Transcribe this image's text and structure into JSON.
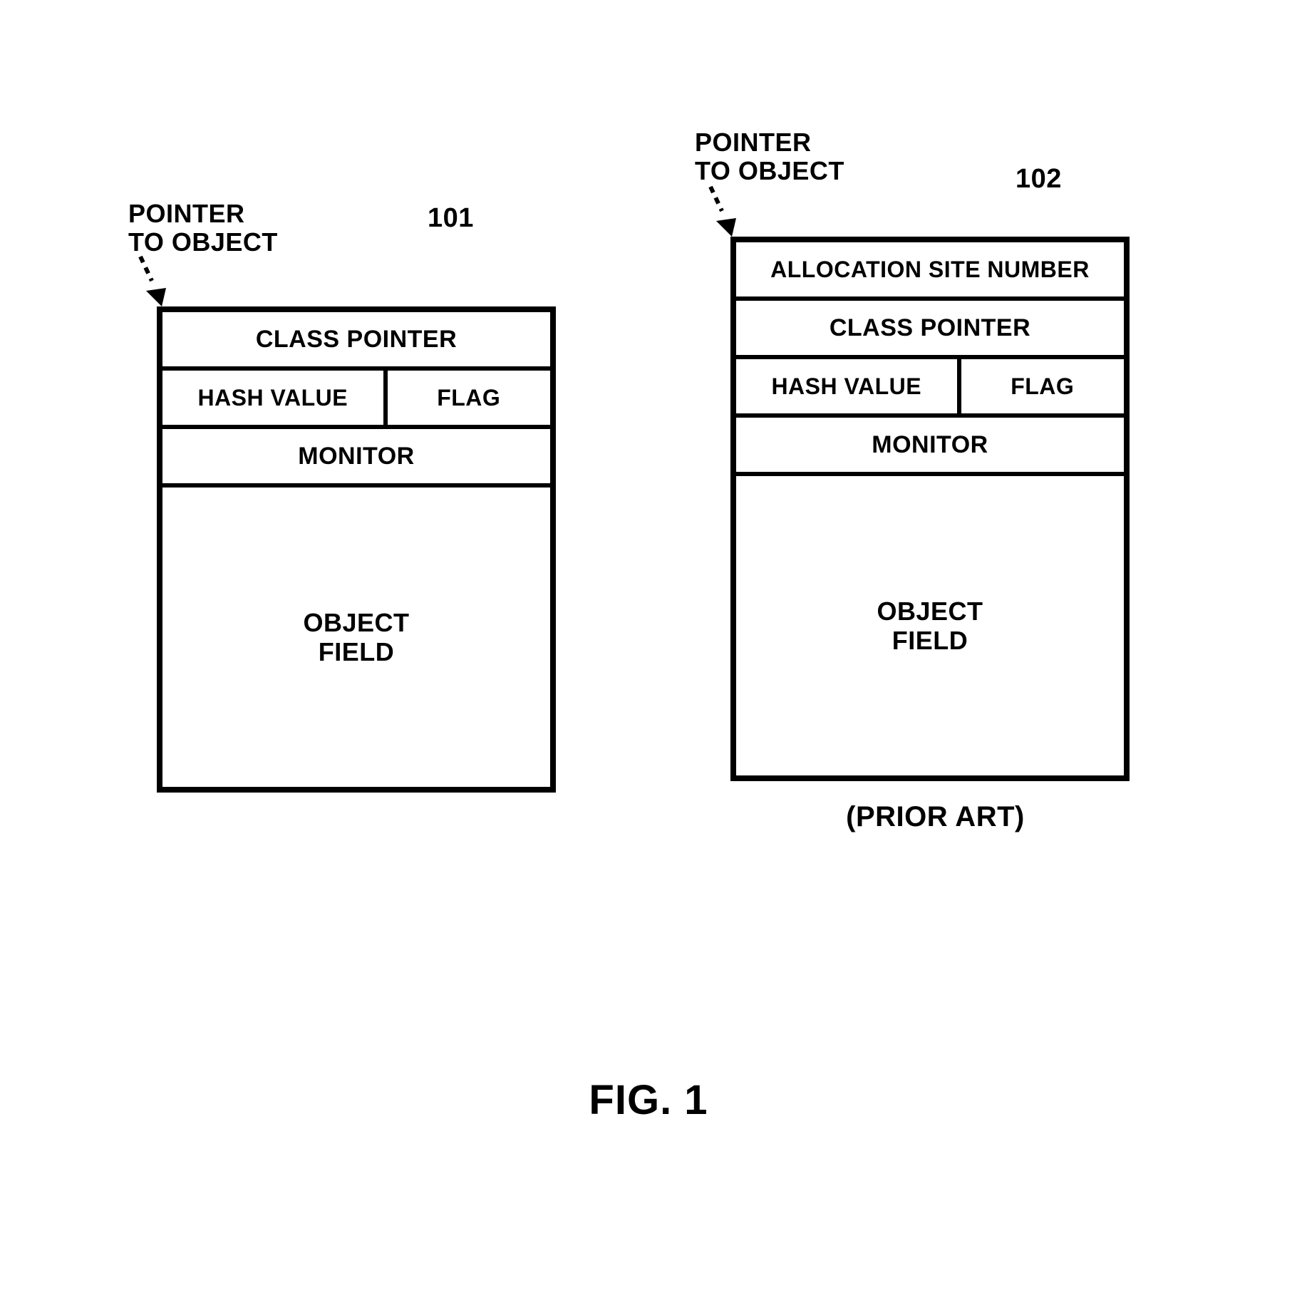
{
  "figure_caption": "FIG. 1",
  "left": {
    "ref": "101",
    "pointer_label_l1": "POINTER",
    "pointer_label_l2": "TO OBJECT",
    "rows": {
      "class_pointer": "CLASS POINTER",
      "hash_value": "HASH VALUE",
      "flag": "FLAG",
      "monitor": "MONITOR",
      "object_field_l1": "OBJECT",
      "object_field_l2": "FIELD"
    }
  },
  "right": {
    "ref": "102",
    "pointer_label_l1": "POINTER",
    "pointer_label_l2": "TO OBJECT",
    "rows": {
      "alloc_site": "ALLOCATION SITE NUMBER",
      "class_pointer": "CLASS POINTER",
      "hash_value": "HASH VALUE",
      "flag": "FLAG",
      "monitor": "MONITOR",
      "object_field_l1": "OBJECT",
      "object_field_l2": "FIELD"
    },
    "below": "(PRIOR ART)"
  }
}
